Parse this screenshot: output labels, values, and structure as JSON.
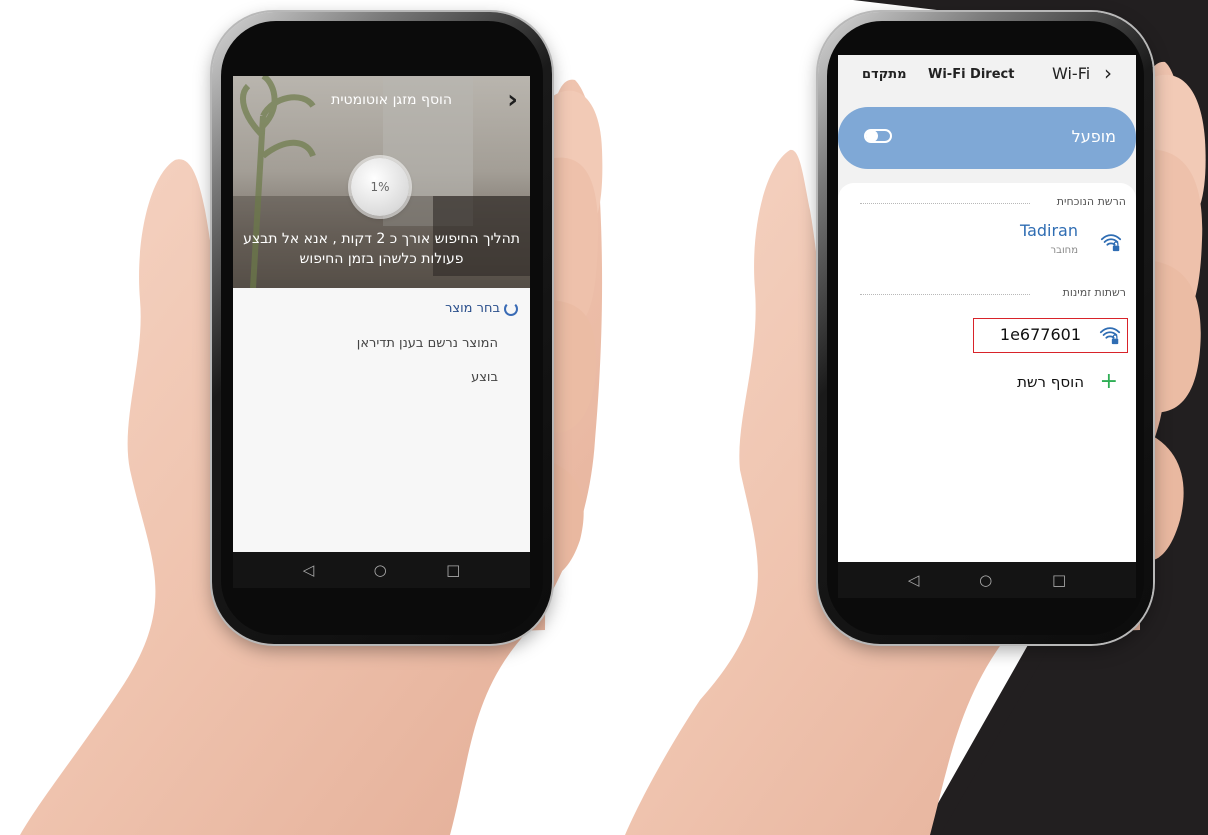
{
  "left_phone": {
    "header": {
      "title": "הוסף מזגן אוטומטית",
      "back_icon": "chevron-right-icon"
    },
    "progress": {
      "label": "1%",
      "value": 0.01
    },
    "message": {
      "line1": "תהליך החיפוש אורך כ 2 דקות , אנא אל תבצע",
      "line2": "פעולות כלשהן בזמן החיפוש"
    },
    "steps": [
      {
        "label": "בחר מוצר",
        "state": "active"
      },
      {
        "label": "המוצר נרשם בענן תדיראן",
        "state": "pending"
      },
      {
        "label": "בוצע",
        "state": "pending"
      }
    ],
    "nav": {
      "back": "◁",
      "home": "○",
      "recents": "□"
    }
  },
  "right_phone": {
    "tabs": {
      "back_icon": "chevron-left-icon",
      "wifi": "Wi-Fi",
      "wifi_direct": "Wi-Fi Direct",
      "advanced": "מתקדם"
    },
    "toggle": {
      "label": "מופעל",
      "on": true
    },
    "current_network": {
      "heading": "הרשת הנוכחית",
      "name": "Tadiran",
      "status": "מחובר"
    },
    "available_networks": {
      "heading": "רשתות זמינות",
      "items": [
        {
          "name": "1e677601",
          "highlighted": true
        }
      ]
    },
    "add_network": {
      "label": "הוסף רשת",
      "icon": "plus-icon"
    },
    "nav": {
      "back": "◁",
      "home": "○",
      "recents": "□"
    }
  },
  "colors": {
    "accent_blue": "#2f6db3",
    "toggle_bar": "#7fa8d6",
    "highlight_red": "#d8232a",
    "add_green": "#2fae55",
    "dark_panel": "#221f20"
  }
}
